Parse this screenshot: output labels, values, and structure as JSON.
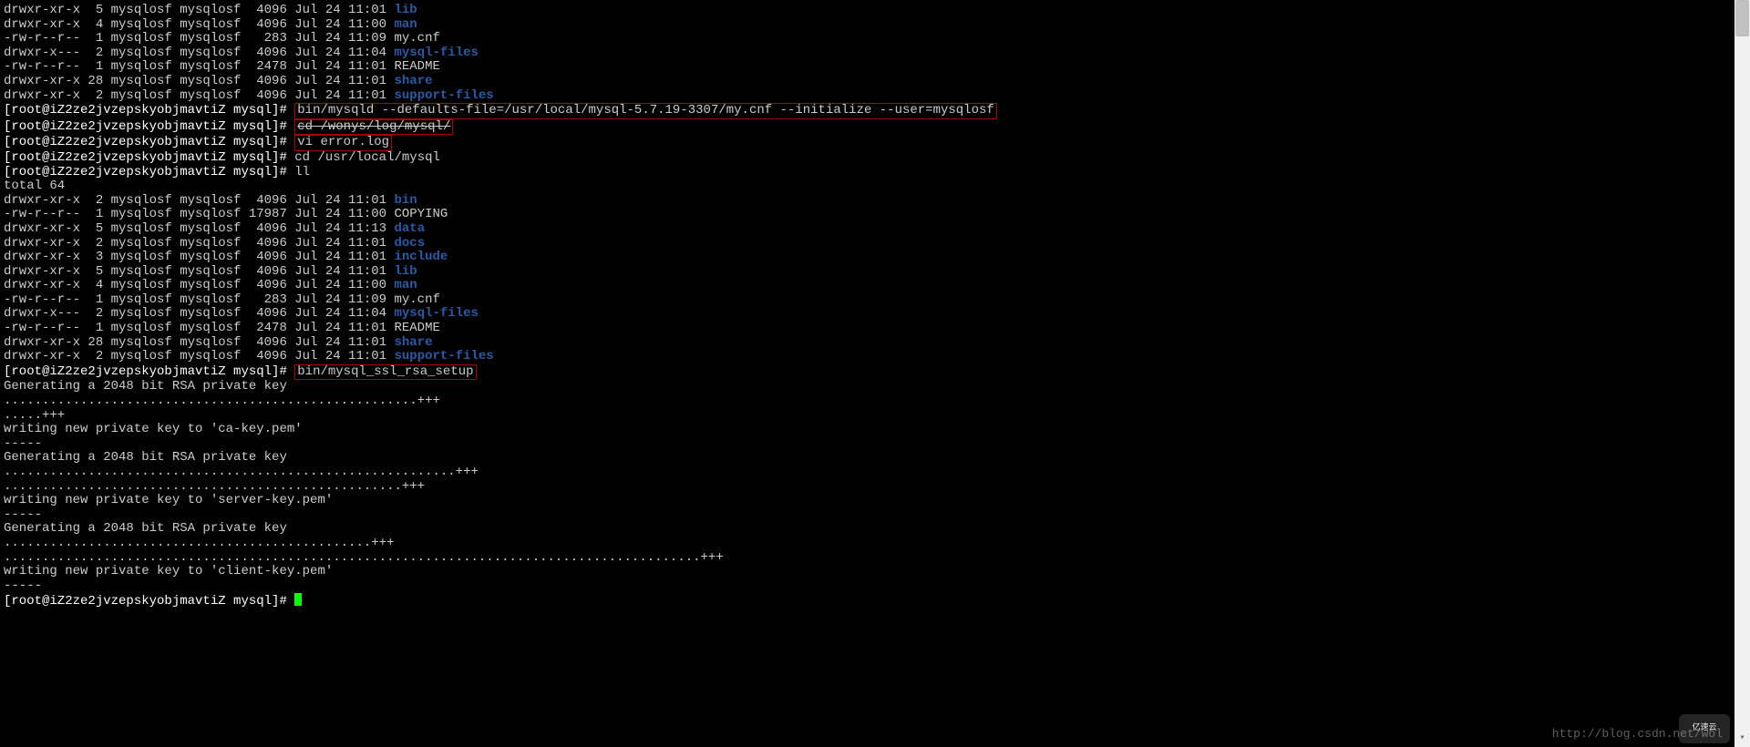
{
  "prompt": "[root@iZ2ze2jvzepskyobjmavtiZ mysql]# ",
  "ls1": [
    {
      "perm": "drwxr-xr-x",
      "n": "5",
      "u": "mysqlosf",
      "g": "mysqlosf",
      "size": "4096",
      "date": "Jul 24 11:01",
      "name": "lib",
      "dir": true
    },
    {
      "perm": "drwxr-xr-x",
      "n": "4",
      "u": "mysqlosf",
      "g": "mysqlosf",
      "size": "4096",
      "date": "Jul 24 11:00",
      "name": "man",
      "dir": true
    },
    {
      "perm": "-rw-r--r--",
      "n": "1",
      "u": "mysqlosf",
      "g": "mysqlosf",
      "size": "283",
      "date": "Jul 24 11:09",
      "name": "my.cnf",
      "dir": false
    },
    {
      "perm": "drwxr-x---",
      "n": "2",
      "u": "mysqlosf",
      "g": "mysqlosf",
      "size": "4096",
      "date": "Jul 24 11:04",
      "name": "mysql-files",
      "dir": true
    },
    {
      "perm": "-rw-r--r--",
      "n": "1",
      "u": "mysqlosf",
      "g": "mysqlosf",
      "size": "2478",
      "date": "Jul 24 11:01",
      "name": "README",
      "dir": false
    },
    {
      "perm": "drwxr-xr-x",
      "n": "28",
      "u": "mysqlosf",
      "g": "mysqlosf",
      "size": "4096",
      "date": "Jul 24 11:01",
      "name": "share",
      "dir": true
    },
    {
      "perm": "drwxr-xr-x",
      "n": "2",
      "u": "mysqlosf",
      "g": "mysqlosf",
      "size": "4096",
      "date": "Jul 24 11:01",
      "name": "support-files",
      "dir": true
    }
  ],
  "cmd1": "bin/mysqld --defaults-file=/usr/local/mysql-5.7.19-3307/my.cnf --initialize --user=mysqlosf",
  "cmd2": "cd /wonys/log/mysql/",
  "cmd3": "vi error.log",
  "cmd4": "cd /usr/local/mysql",
  "cmd5": "ll",
  "total": "total 64",
  "ls2": [
    {
      "perm": "drwxr-xr-x",
      "n": "2",
      "u": "mysqlosf",
      "g": "mysqlosf",
      "size": "4096",
      "date": "Jul 24 11:01",
      "name": "bin",
      "dir": true
    },
    {
      "perm": "-rw-r--r--",
      "n": "1",
      "u": "mysqlosf",
      "g": "mysqlosf",
      "size": "17987",
      "date": "Jul 24 11:00",
      "name": "COPYING",
      "dir": false
    },
    {
      "perm": "drwxr-xr-x",
      "n": "5",
      "u": "mysqlosf",
      "g": "mysqlosf",
      "size": "4096",
      "date": "Jul 24 11:13",
      "name": "data",
      "dir": true
    },
    {
      "perm": "drwxr-xr-x",
      "n": "2",
      "u": "mysqlosf",
      "g": "mysqlosf",
      "size": "4096",
      "date": "Jul 24 11:01",
      "name": "docs",
      "dir": true
    },
    {
      "perm": "drwxr-xr-x",
      "n": "3",
      "u": "mysqlosf",
      "g": "mysqlosf",
      "size": "4096",
      "date": "Jul 24 11:01",
      "name": "include",
      "dir": true
    },
    {
      "perm": "drwxr-xr-x",
      "n": "5",
      "u": "mysqlosf",
      "g": "mysqlosf",
      "size": "4096",
      "date": "Jul 24 11:01",
      "name": "lib",
      "dir": true
    },
    {
      "perm": "drwxr-xr-x",
      "n": "4",
      "u": "mysqlosf",
      "g": "mysqlosf",
      "size": "4096",
      "date": "Jul 24 11:00",
      "name": "man",
      "dir": true
    },
    {
      "perm": "-rw-r--r--",
      "n": "1",
      "u": "mysqlosf",
      "g": "mysqlosf",
      "size": "283",
      "date": "Jul 24 11:09",
      "name": "my.cnf",
      "dir": false
    },
    {
      "perm": "drwxr-x---",
      "n": "2",
      "u": "mysqlosf",
      "g": "mysqlosf",
      "size": "4096",
      "date": "Jul 24 11:04",
      "name": "mysql-files",
      "dir": true
    },
    {
      "perm": "-rw-r--r--",
      "n": "1",
      "u": "mysqlosf",
      "g": "mysqlosf",
      "size": "2478",
      "date": "Jul 24 11:01",
      "name": "README",
      "dir": false
    },
    {
      "perm": "drwxr-xr-x",
      "n": "28",
      "u": "mysqlosf",
      "g": "mysqlosf",
      "size": "4096",
      "date": "Jul 24 11:01",
      "name": "share",
      "dir": true
    },
    {
      "perm": "drwxr-xr-x",
      "n": "2",
      "u": "mysqlosf",
      "g": "mysqlosf",
      "size": "4096",
      "date": "Jul 24 11:01",
      "name": "support-files",
      "dir": true
    }
  ],
  "cmd6": "bin/mysql_ssl_rsa_setup",
  "ssl_output": [
    "Generating a 2048 bit RSA private key",
    "......................................................+++",
    ".....+++",
    "writing new private key to 'ca-key.pem'",
    "-----",
    "Generating a 2048 bit RSA private key",
    "...........................................................+++",
    "....................................................+++",
    "writing new private key to 'server-key.pem'",
    "-----",
    "Generating a 2048 bit RSA private key",
    "................................................+++",
    "...........................................................................................+++",
    "writing new private key to 'client-key.pem'",
    "-----"
  ],
  "watermark": "http://blog.csdn.net/wol",
  "logo_text": "亿速云"
}
